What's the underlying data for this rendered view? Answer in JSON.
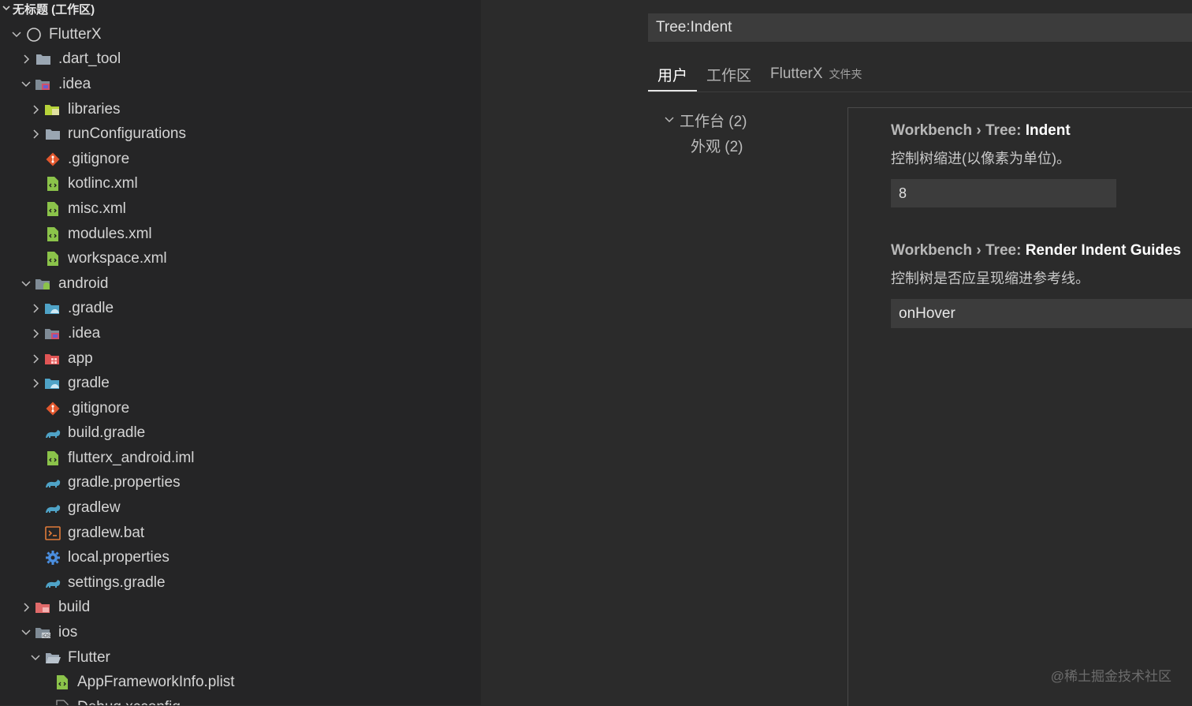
{
  "workspace": {
    "title": "无标题 (工作区)"
  },
  "tree": [
    {
      "label": "FlutterX",
      "depth": 0,
      "twisty": "open",
      "icon": "root"
    },
    {
      "label": ".dart_tool",
      "depth": 1,
      "twisty": "closed",
      "icon": "folder"
    },
    {
      "label": ".idea",
      "depth": 1,
      "twisty": "open",
      "icon": "folder-idea"
    },
    {
      "label": "libraries",
      "depth": 2,
      "twisty": "closed",
      "icon": "folder-lib"
    },
    {
      "label": "runConfigurations",
      "depth": 2,
      "twisty": "closed",
      "icon": "folder"
    },
    {
      "label": ".gitignore",
      "depth": 2,
      "twisty": "none",
      "icon": "git"
    },
    {
      "label": "kotlinc.xml",
      "depth": 2,
      "twisty": "none",
      "icon": "xml"
    },
    {
      "label": "misc.xml",
      "depth": 2,
      "twisty": "none",
      "icon": "xml"
    },
    {
      "label": "modules.xml",
      "depth": 2,
      "twisty": "none",
      "icon": "xml"
    },
    {
      "label": "workspace.xml",
      "depth": 2,
      "twisty": "none",
      "icon": "xml"
    },
    {
      "label": "android",
      "depth": 1,
      "twisty": "open",
      "icon": "folder-android"
    },
    {
      "label": ".gradle",
      "depth": 2,
      "twisty": "closed",
      "icon": "folder-gradle"
    },
    {
      "label": ".idea",
      "depth": 2,
      "twisty": "closed",
      "icon": "folder-idea"
    },
    {
      "label": "app",
      "depth": 2,
      "twisty": "closed",
      "icon": "folder-app"
    },
    {
      "label": "gradle",
      "depth": 2,
      "twisty": "closed",
      "icon": "folder-gradle"
    },
    {
      "label": ".gitignore",
      "depth": 2,
      "twisty": "none",
      "icon": "git"
    },
    {
      "label": "build.gradle",
      "depth": 2,
      "twisty": "none",
      "icon": "gradle"
    },
    {
      "label": "flutterx_android.iml",
      "depth": 2,
      "twisty": "none",
      "icon": "xml"
    },
    {
      "label": "gradle.properties",
      "depth": 2,
      "twisty": "none",
      "icon": "gradle"
    },
    {
      "label": "gradlew",
      "depth": 2,
      "twisty": "none",
      "icon": "gradle"
    },
    {
      "label": "gradlew.bat",
      "depth": 2,
      "twisty": "none",
      "icon": "terminal"
    },
    {
      "label": "local.properties",
      "depth": 2,
      "twisty": "none",
      "icon": "gear"
    },
    {
      "label": "settings.gradle",
      "depth": 2,
      "twisty": "none",
      "icon": "gradle"
    },
    {
      "label": "build",
      "depth": 1,
      "twisty": "closed",
      "icon": "folder-build"
    },
    {
      "label": "ios",
      "depth": 1,
      "twisty": "open",
      "icon": "folder-ios"
    },
    {
      "label": "Flutter",
      "depth": 2,
      "twisty": "open",
      "icon": "folder-open"
    },
    {
      "label": "AppFrameworkInfo.plist",
      "depth": 3,
      "twisty": "none",
      "icon": "xml"
    },
    {
      "label": "Debug.xcconfig",
      "depth": 3,
      "twisty": "none",
      "icon": "file"
    }
  ],
  "settings": {
    "search": {
      "value": "Tree:Indent"
    },
    "tabs": [
      {
        "label": "用户",
        "active": true
      },
      {
        "label": "工作区",
        "active": false
      },
      {
        "label": "FlutterX",
        "sub": "文件夹",
        "active": false
      }
    ],
    "toc": [
      {
        "label": "工作台 (2)",
        "twisty": "open"
      },
      {
        "label": "外观 (2)",
        "twisty": "none"
      }
    ],
    "indent": {
      "prefix": "Workbench › Tree: ",
      "key": "Indent",
      "description": "控制树缩进(以像素为单位)。",
      "value": "8"
    },
    "guides": {
      "prefix": "Workbench › Tree: ",
      "key": "Render Indent Guides",
      "description": "控制树是否应呈现缩进参考线。",
      "value": "onHover"
    }
  },
  "watermark": "@稀土掘金技术社区",
  "colors": {
    "background": "#2b2b2b",
    "sidebar": "#252526",
    "input": "#3c3c3c"
  }
}
